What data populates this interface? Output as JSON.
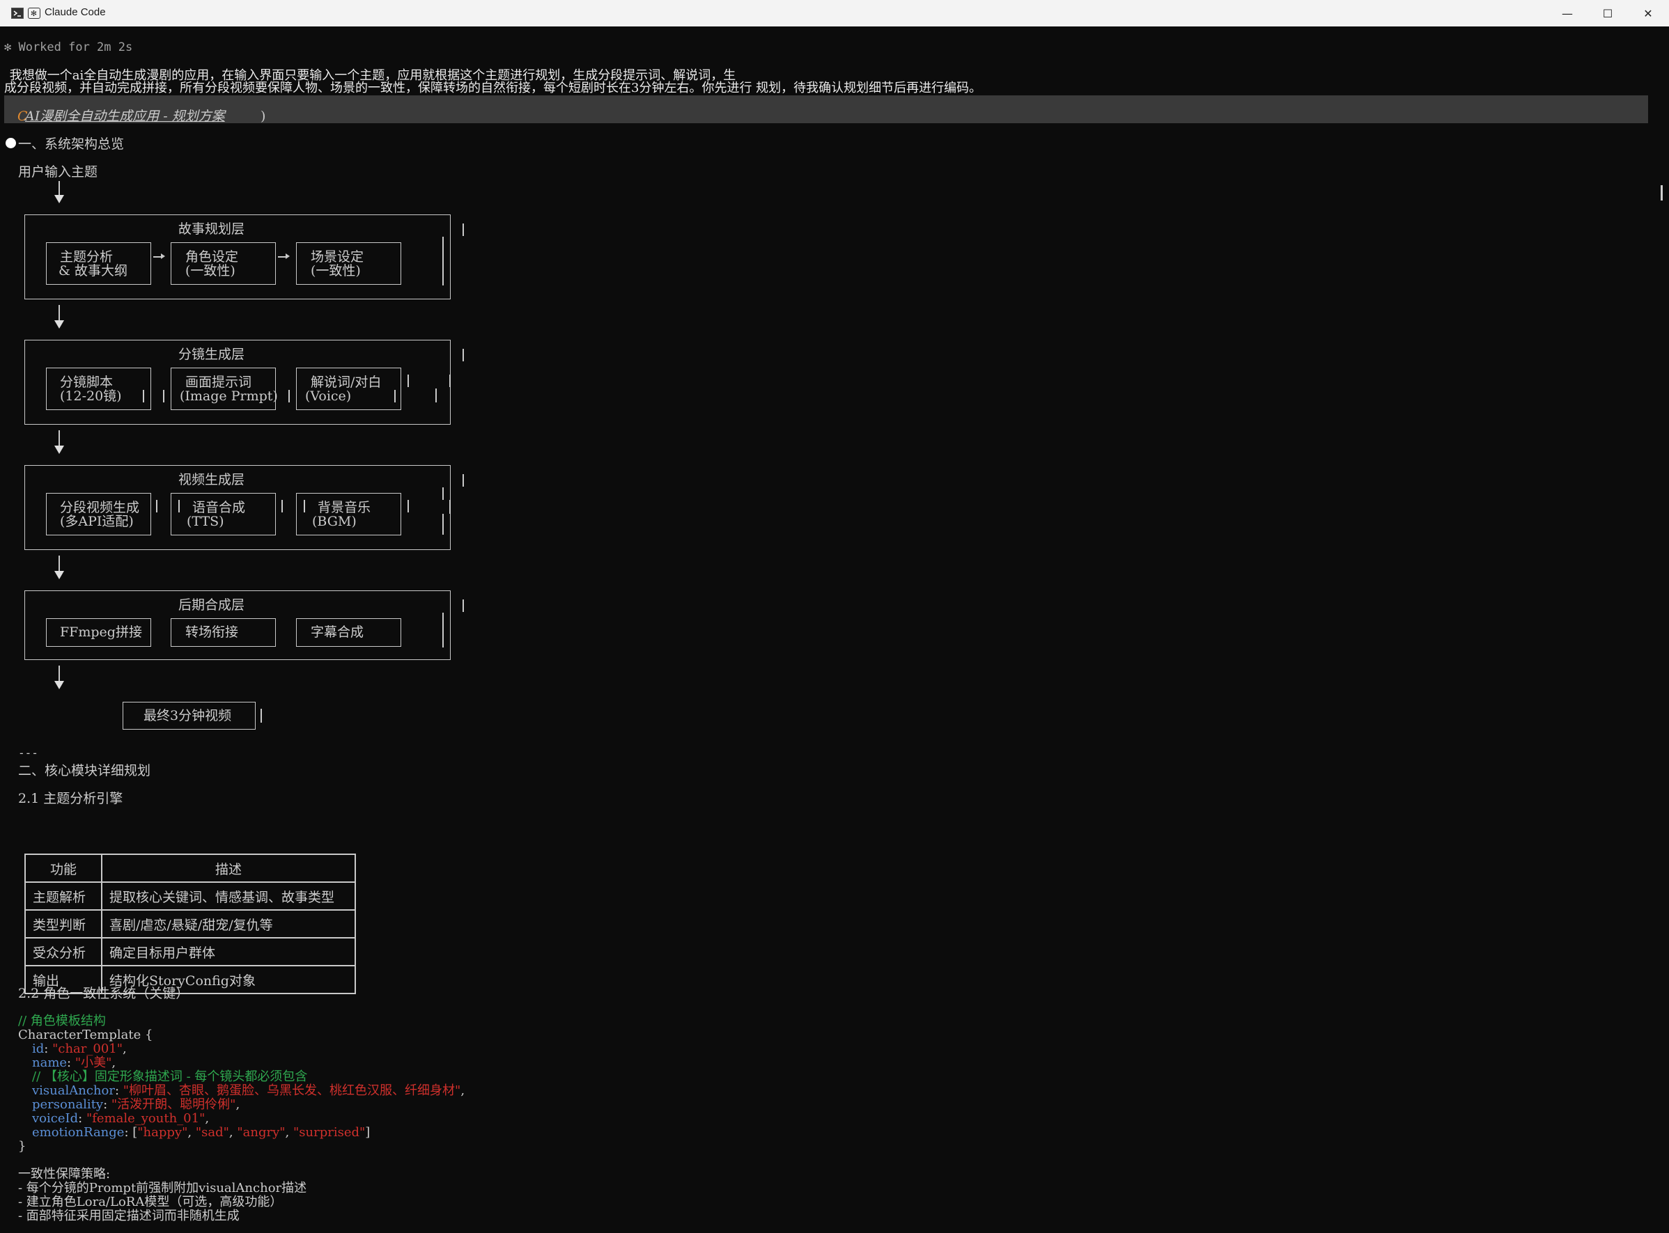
{
  "window": {
    "title": "Claude Code",
    "icons": [
      "terminal-icon",
      "claude-icon"
    ],
    "controls": {
      "minimize": "—",
      "maximize": "☐",
      "close": "✕"
    }
  },
  "status": "✻ Worked for 2m 2s",
  "prompt": {
    "line1": " 我想做一个ai全自动生成漫剧的应用，在输入界面只要输入一个主题，应用就根据这个主题进行规划，生成分段提示词、解说词，生",
    "line2": "成分段视频，并自动完成拼接，所有分段视频要保障人物、场景的一致性，保障转场的自然衔接，每个短剧时长在3分钟左右。你先进行 规划，待我确认规划细节后再进行编码。"
  },
  "response": {
    "heading_prefix": "C",
    "heading": "AI漫剧全自动生成应用 - 规划方案",
    "heading_suffix": ")",
    "section1": "一、系统架构总览",
    "input_label": "用户输入主题",
    "layers": [
      {
        "title": "故事规划层",
        "items": [
          [
            "主题分析",
            "& 故事大纲"
          ],
          [
            "角色设定",
            "(一致性)"
          ],
          [
            "场景设定",
            "(一致性)"
          ]
        ]
      },
      {
        "title": "分镜生成层",
        "items": [
          [
            "分镜脚本",
            "(12-20镜)"
          ],
          [
            "画面提示词",
            "(Image Prmpt)"
          ],
          [
            "解说词/对白",
            "(Voice)"
          ]
        ]
      },
      {
        "title": "视频生成层",
        "items": [
          [
            "分段视频生成",
            "(多API适配)"
          ],
          [
            "语音合成",
            "(TTS)"
          ],
          [
            "背景音乐",
            "(BGM)"
          ]
        ]
      },
      {
        "title": "后期合成层",
        "items": [
          [
            "FFmpeg拼接"
          ],
          [
            "转场衔接"
          ],
          [
            "字幕合成"
          ]
        ]
      }
    ],
    "final_output": "最终3分钟视频",
    "separator": "---",
    "section2": "二、核心模块详细规划",
    "sub21": "2.1 主题分析引擎",
    "table": {
      "headers": [
        "功能",
        "描述"
      ],
      "rows": [
        [
          "主题解析",
          "提取核心关键词、情感基调、故事类型"
        ],
        [
          "类型判断",
          "喜剧/虐恋/悬疑/甜宠/复仇等"
        ],
        [
          "受众分析",
          "确定目标用户群体"
        ],
        [
          "输出",
          "结构化StoryConfig对象"
        ]
      ]
    },
    "sub22": "2.2 角色一致性系统（关键）",
    "code": {
      "comment1": "// 角色模板结构",
      "decl": "CharacterTemplate {",
      "id_key": "id",
      "id_val": "\"char_001\"",
      "name_key": "name",
      "name_val": "\"小美\"",
      "comment2": "// 【核心】固定形象描述词 - 每个镜头都必须包含",
      "visual_key": "visualAnchor",
      "visual_val": "\"柳叶眉、杏眼、鹅蛋脸、乌黑长发、桃红色汉服、纤细身材\"",
      "personality_key": "personality",
      "personality_val": "\"活泼开朗、聪明伶俐\"",
      "voice_key": "voiceId",
      "voice_val": "\"female_youth_01\"",
      "emotion_key": "emotionRange",
      "emotions": [
        "\"happy\"",
        "\"sad\"",
        "\"angry\"",
        "\"surprised\""
      ],
      "close": "}"
    },
    "strategy_title": "一致性保障策略:",
    "strategy": [
      "- 每个分镜的Prompt前强制附加visualAnchor描述",
      "- 建立角色Lora/LoRA模型（可选，高级功能）",
      "- 面部特征采用固定描述词而非随机生成"
    ]
  }
}
